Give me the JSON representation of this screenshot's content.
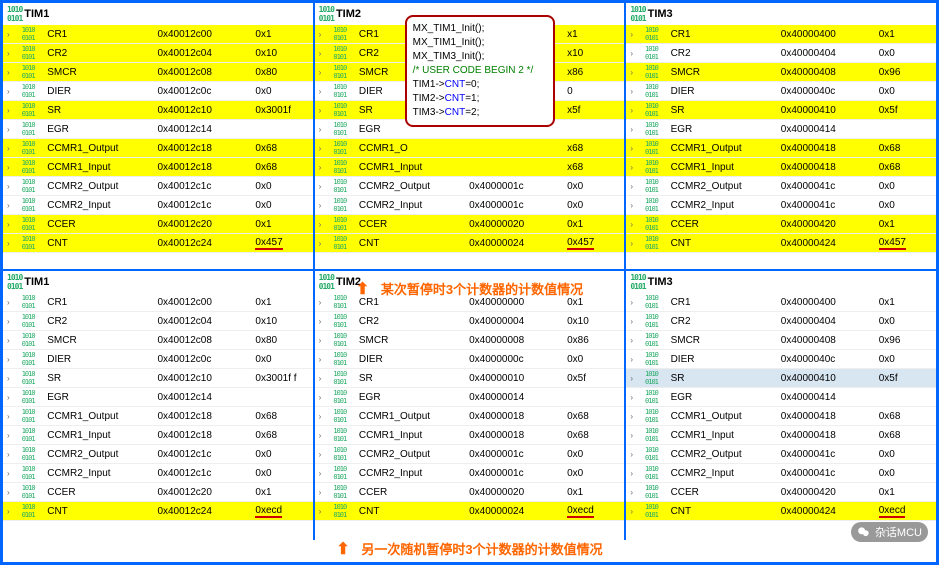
{
  "caption1": "某次暂停时3个计数器的计数值情况",
  "caption2": "另一次随机暂停时3个计数器的计数值情况",
  "watermark": "杂话MCU",
  "code": {
    "l1": "MX_TIM1_Init();",
    "l2": "MX_TIM1_Init();",
    "l3": "MX_TIM3_Init();",
    "l4": "/* USER CODE BEGIN 2 */",
    "l5a": "TIM1->",
    "l5b": "CNT",
    "l5c": "=0;",
    "l6a": "TIM2->",
    "l6b": "CNT",
    "l6c": "=1;",
    "l7a": "TIM3->",
    "l7b": "CNT",
    "l7c": "=2;"
  },
  "panels": [
    {
      "id": "top-tim1",
      "title": "TIM1",
      "rows": [
        {
          "e": "›",
          "n": "CR1",
          "a": "0x40012c00",
          "v": "0x1",
          "hl": 1
        },
        {
          "e": "›",
          "n": "CR2",
          "a": "0x40012c04",
          "v": "0x10",
          "hl": 1
        },
        {
          "e": "›",
          "n": "SMCR",
          "a": "0x40012c08",
          "v": "0x80",
          "hl": 1
        },
        {
          "e": "›",
          "n": "DIER",
          "a": "0x40012c0c",
          "v": "0x0"
        },
        {
          "e": "›",
          "n": "SR",
          "a": "0x40012c10",
          "v": "0x3001f",
          "hl": 1
        },
        {
          "e": "›",
          "n": "EGR",
          "a": "0x40012c14",
          "v": ""
        },
        {
          "e": "›",
          "n": "CCMR1_Output",
          "a": "0x40012c18",
          "v": "0x68",
          "hl": 1
        },
        {
          "e": "›",
          "n": "CCMR1_Input",
          "a": "0x40012c18",
          "v": "0x68",
          "hl": 1
        },
        {
          "e": "›",
          "n": "CCMR2_Output",
          "a": "0x40012c1c",
          "v": "0x0"
        },
        {
          "e": "›",
          "n": "CCMR2_Input",
          "a": "0x40012c1c",
          "v": "0x0"
        },
        {
          "e": "›",
          "n": "CCER",
          "a": "0x40012c20",
          "v": "0x1",
          "hl": 1
        },
        {
          "e": "›",
          "n": "CNT",
          "a": "0x40012c24",
          "v": "0x457",
          "hl": 1,
          "ul": 1
        }
      ]
    },
    {
      "id": "top-tim2",
      "title": "TIM2",
      "rows": [
        {
          "e": "›",
          "n": "CR1",
          "a": "",
          "v": "x1",
          "hl": 1
        },
        {
          "e": "›",
          "n": "CR2",
          "a": "",
          "v": "x10",
          "hl": 1
        },
        {
          "e": "›",
          "n": "SMCR",
          "a": "",
          "v": "x86",
          "hl": 1
        },
        {
          "e": "›",
          "n": "DIER",
          "a": "",
          "v": "0"
        },
        {
          "e": "›",
          "n": "SR",
          "a": "",
          "v": "x5f",
          "hl": 1
        },
        {
          "e": "›",
          "n": "EGR",
          "a": "",
          "v": ""
        },
        {
          "e": "›",
          "n": "CCMR1_O",
          "a": "",
          "v": "x68",
          "hl": 1
        },
        {
          "e": "›",
          "n": "CCMR1_Input",
          "a": "",
          "v": "x68",
          "hl": 1
        },
        {
          "e": "›",
          "n": "CCMR2_Output",
          "a": "0x4000001c",
          "v": "0x0"
        },
        {
          "e": "›",
          "n": "CCMR2_Input",
          "a": "0x4000001c",
          "v": "0x0"
        },
        {
          "e": "›",
          "n": "CCER",
          "a": "0x40000020",
          "v": "0x1",
          "hl": 1
        },
        {
          "e": "›",
          "n": "CNT",
          "a": "0x40000024",
          "v": "0x457",
          "hl": 1,
          "ul": 1
        }
      ]
    },
    {
      "id": "top-tim3",
      "title": "TIM3",
      "rows": [
        {
          "e": "›",
          "n": "CR1",
          "a": "0x40000400",
          "v": "0x1",
          "hl": 1
        },
        {
          "e": "›",
          "n": "CR2",
          "a": "0x40000404",
          "v": "0x0"
        },
        {
          "e": "›",
          "n": "SMCR",
          "a": "0x40000408",
          "v": "0x96",
          "hl": 1
        },
        {
          "e": "›",
          "n": "DIER",
          "a": "0x4000040c",
          "v": "0x0"
        },
        {
          "e": "›",
          "n": "SR",
          "a": "0x40000410",
          "v": "0x5f",
          "hl": 1
        },
        {
          "e": "›",
          "n": "EGR",
          "a": "0x40000414",
          "v": ""
        },
        {
          "e": "›",
          "n": "CCMR1_Output",
          "a": "0x40000418",
          "v": "0x68",
          "hl": 1
        },
        {
          "e": "›",
          "n": "CCMR1_Input",
          "a": "0x40000418",
          "v": "0x68",
          "hl": 1
        },
        {
          "e": "›",
          "n": "CCMR2_Output",
          "a": "0x4000041c",
          "v": "0x0"
        },
        {
          "e": "›",
          "n": "CCMR2_Input",
          "a": "0x4000041c",
          "v": "0x0"
        },
        {
          "e": "›",
          "n": "CCER",
          "a": "0x40000420",
          "v": "0x1",
          "hl": 1
        },
        {
          "e": "›",
          "n": "CNT",
          "a": "0x40000424",
          "v": "0x457",
          "hl": 1,
          "ul": 1
        }
      ]
    },
    {
      "id": "bot-tim1",
      "title": "TIM1",
      "rows": [
        {
          "e": "›",
          "n": "CR1",
          "a": "0x40012c00",
          "v": "0x1"
        },
        {
          "e": "›",
          "n": "CR2",
          "a": "0x40012c04",
          "v": "0x10"
        },
        {
          "e": "›",
          "n": "SMCR",
          "a": "0x40012c08",
          "v": "0x80"
        },
        {
          "e": "›",
          "n": "DIER",
          "a": "0x40012c0c",
          "v": "0x0"
        },
        {
          "e": "›",
          "n": "SR",
          "a": "0x40012c10",
          "v": "0x3001f f"
        },
        {
          "e": "›",
          "n": "EGR",
          "a": "0x40012c14",
          "v": ""
        },
        {
          "e": "›",
          "n": "CCMR1_Output",
          "a": "0x40012c18",
          "v": "0x68"
        },
        {
          "e": "›",
          "n": "CCMR1_Input",
          "a": "0x40012c18",
          "v": "0x68"
        },
        {
          "e": "›",
          "n": "CCMR2_Output",
          "a": "0x40012c1c",
          "v": "0x0"
        },
        {
          "e": "›",
          "n": "CCMR2_Input",
          "a": "0x40012c1c",
          "v": "0x0"
        },
        {
          "e": "›",
          "n": "CCER",
          "a": "0x40012c20",
          "v": "0x1"
        },
        {
          "e": "›",
          "n": "CNT",
          "a": "0x40012c24",
          "v": "0xecd",
          "hl": 1,
          "ul": 1
        }
      ]
    },
    {
      "id": "bot-tim2",
      "title": "TIM2",
      "rows": [
        {
          "e": "›",
          "n": "CR1",
          "a": "0x40000000",
          "v": "0x1"
        },
        {
          "e": "›",
          "n": "CR2",
          "a": "0x40000004",
          "v": "0x10"
        },
        {
          "e": "›",
          "n": "SMCR",
          "a": "0x40000008",
          "v": "0x86"
        },
        {
          "e": "›",
          "n": "DIER",
          "a": "0x4000000c",
          "v": "0x0"
        },
        {
          "e": "›",
          "n": "SR",
          "a": "0x40000010",
          "v": "0x5f"
        },
        {
          "e": "›",
          "n": "EGR",
          "a": "0x40000014",
          "v": ""
        },
        {
          "e": "›",
          "n": "CCMR1_Output",
          "a": "0x40000018",
          "v": "0x68"
        },
        {
          "e": "›",
          "n": "CCMR1_Input",
          "a": "0x40000018",
          "v": "0x68"
        },
        {
          "e": "›",
          "n": "CCMR2_Output",
          "a": "0x4000001c",
          "v": "0x0"
        },
        {
          "e": "›",
          "n": "CCMR2_Input",
          "a": "0x4000001c",
          "v": "0x0"
        },
        {
          "e": "›",
          "n": "CCER",
          "a": "0x40000020",
          "v": "0x1"
        },
        {
          "e": "›",
          "n": "CNT",
          "a": "0x40000024",
          "v": "0xecd",
          "hl": 1,
          "ul": 1
        }
      ]
    },
    {
      "id": "bot-tim3",
      "title": "TIM3",
      "rows": [
        {
          "e": "›",
          "n": "CR1",
          "a": "0x40000400",
          "v": "0x1"
        },
        {
          "e": "›",
          "n": "CR2",
          "a": "0x40000404",
          "v": "0x0"
        },
        {
          "e": "›",
          "n": "SMCR",
          "a": "0x40000408",
          "v": "0x96"
        },
        {
          "e": "›",
          "n": "DIER",
          "a": "0x4000040c",
          "v": "0x0"
        },
        {
          "e": "›",
          "n": "SR",
          "a": "0x40000410",
          "v": "0x5f",
          "sel": 1
        },
        {
          "e": "›",
          "n": "EGR",
          "a": "0x40000414",
          "v": ""
        },
        {
          "e": "›",
          "n": "CCMR1_Output",
          "a": "0x40000418",
          "v": "0x68"
        },
        {
          "e": "›",
          "n": "CCMR1_Input",
          "a": "0x40000418",
          "v": "0x68"
        },
        {
          "e": "›",
          "n": "CCMR2_Output",
          "a": "0x4000041c",
          "v": "0x0"
        },
        {
          "e": "›",
          "n": "CCMR2_Input",
          "a": "0x4000041c",
          "v": "0x0"
        },
        {
          "e": "›",
          "n": "CCER",
          "a": "0x40000420",
          "v": "0x1"
        },
        {
          "e": "›",
          "n": "CNT",
          "a": "0x40000424",
          "v": "0xecd",
          "hl": 1,
          "ul": 1
        }
      ]
    }
  ]
}
